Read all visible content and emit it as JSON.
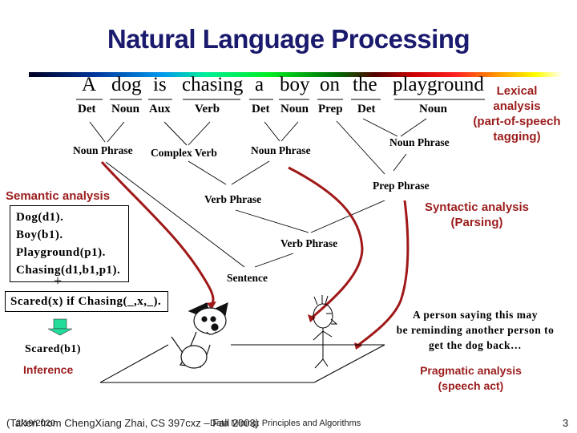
{
  "slide": {
    "title": "Natural Language Processing",
    "page_number": "3"
  },
  "sentence": {
    "words": [
      "A",
      "dog",
      "is",
      "chasing",
      "a",
      "boy",
      "on",
      "the",
      "playground"
    ],
    "pos_tags": [
      "Det",
      "Noun",
      "Aux",
      "Verb",
      "Det",
      "Noun",
      "Prep",
      "Det",
      "Noun"
    ]
  },
  "parse_tree": {
    "noun_phrase_1": "Noun Phrase",
    "complex_verb": "Complex Verb",
    "noun_phrase_2": "Noun Phrase",
    "noun_phrase_3": "Noun Phrase",
    "prep_phrase": "Prep Phrase",
    "verb_phrase_1": "Verb Phrase",
    "verb_phrase_2": "Verb Phrase",
    "sentence": "Sentence"
  },
  "labels": {
    "lexical": [
      "Lexical",
      "analysis",
      "(part-of-speech",
      "tagging)"
    ],
    "syntactic": [
      "Syntactic analysis",
      "(Parsing)"
    ],
    "semantic": "Semantic analysis",
    "inference": "Inference",
    "pragmatic": [
      "Pragmatic analysis",
      "(speech act)"
    ]
  },
  "semantic_box": [
    "Dog(d1).",
    "Boy(b1).",
    "Playground(p1).",
    "Chasing(d1,b1,p1)."
  ],
  "plus_sign": "+",
  "rule_box": "Scared(x) if Chasing(_,x,_).",
  "inference_result": "Scared(b1)",
  "pragmatic_note": [
    "A person saying this may",
    "be reminding another person to",
    "get the dog back…"
  ],
  "footer": {
    "source": "(Taken from ChengXiang Zhai, CS 397cxz – Fall 2003)",
    "date": "2/19/2020",
    "course": "Data Mining: Principles and Algorithms"
  },
  "colors": {
    "title": "#1a1a6e",
    "annotation_red": "#9b1c1c",
    "arrow_green": "#22dd99"
  }
}
